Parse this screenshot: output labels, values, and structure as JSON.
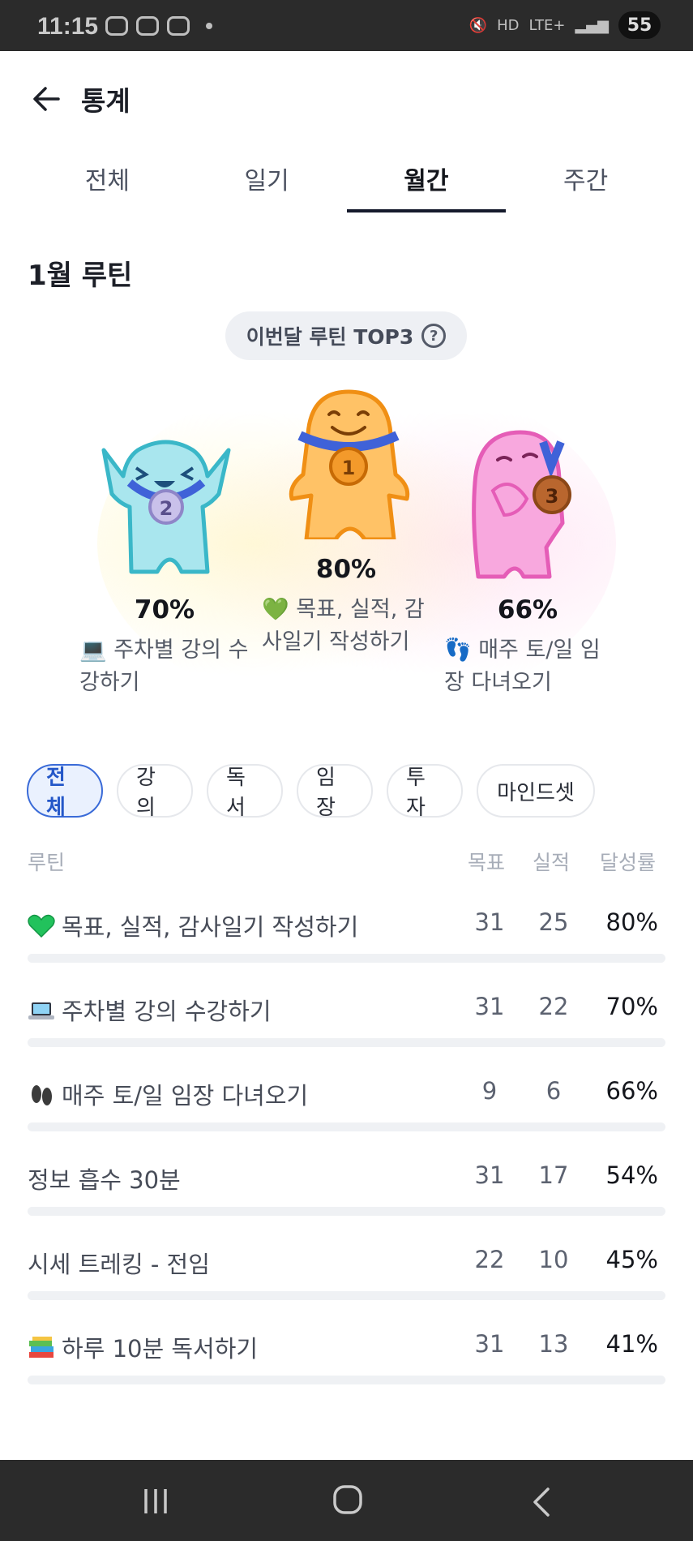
{
  "status_bar": {
    "time": "11:15",
    "battery": "55",
    "network": "LTE+",
    "hd": "HD"
  },
  "header": {
    "title": "통계",
    "back_icon": "arrow-left-icon"
  },
  "tabs": [
    {
      "label": "전체",
      "active": false
    },
    {
      "label": "일기",
      "active": false
    },
    {
      "label": "월간",
      "active": true
    },
    {
      "label": "주간",
      "active": false
    }
  ],
  "section_title": "1월 루틴",
  "top3": {
    "pill_label": "이번달 루틴 TOP3",
    "help_icon": "question-circle-icon",
    "ranks": [
      {
        "rank": "1",
        "percent": "80%",
        "name_line1": "💚 목표, 실적, 감",
        "name_line2": "사일기 작성하기",
        "color": "#f6a23a"
      },
      {
        "rank": "2",
        "percent": "70%",
        "name_line1": "💻 주차별 강의 수",
        "name_line2": "강하기",
        "color": "#45bfcf"
      },
      {
        "rank": "3",
        "percent": "66%",
        "name_line1": "👣 매주 토/일 임",
        "name_line2": "장 다녀오기",
        "color": "#ef72c5"
      }
    ]
  },
  "chips": [
    {
      "label": "전체",
      "active": true
    },
    {
      "label": "강의",
      "active": false
    },
    {
      "label": "독서",
      "active": false
    },
    {
      "label": "임장",
      "active": false
    },
    {
      "label": "투자",
      "active": false
    },
    {
      "label": "마인드셋",
      "active": false
    }
  ],
  "table": {
    "headers": {
      "routine": "루틴",
      "goal": "목표",
      "actual": "실적",
      "rate": "달성률"
    },
    "rows": [
      {
        "emoji": "green-heart-icon",
        "name": "목표, 실적, 감사일기 작성하기",
        "goal": "31",
        "actual": "25",
        "rate": "80%"
      },
      {
        "emoji": "laptop-icon",
        "name": "주차별 강의 수강하기",
        "goal": "31",
        "actual": "22",
        "rate": "70%"
      },
      {
        "emoji": "footprints-icon",
        "name": "매주 토/일 임장 다녀오기",
        "goal": "9",
        "actual": "6",
        "rate": "66%"
      },
      {
        "emoji": "",
        "name": "정보 흡수 30분",
        "goal": "31",
        "actual": "17",
        "rate": "54%"
      },
      {
        "emoji": "",
        "name": "시세 트레킹 - 전임",
        "goal": "22",
        "actual": "10",
        "rate": "45%"
      },
      {
        "emoji": "books-icon",
        "name": "하루 10분 독서하기",
        "goal": "31",
        "actual": "13",
        "rate": "41%"
      }
    ]
  },
  "colors": {
    "accent": "#2457c8",
    "chip_active_bg": "#eaf1fe",
    "tab_indicator": "#151a2c"
  }
}
